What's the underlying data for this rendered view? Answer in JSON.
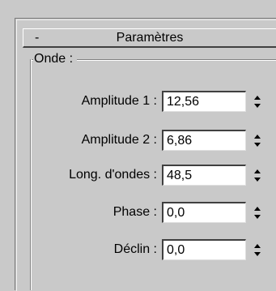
{
  "rollout": {
    "collapse_symbol": "-",
    "title": "Paramètres"
  },
  "group": {
    "label": "Onde :"
  },
  "params": [
    {
      "label": "Amplitude 1 :",
      "value": "12,56"
    },
    {
      "label": "Amplitude 2 :",
      "value": "6,86"
    },
    {
      "label": "Long. d'ondes :",
      "value": "48,5"
    },
    {
      "label": "Phase :",
      "value": "0,0"
    },
    {
      "label": "Déclin :",
      "value": "0,0"
    }
  ],
  "icons": {
    "spinner": "spinner-arrows-icon"
  }
}
